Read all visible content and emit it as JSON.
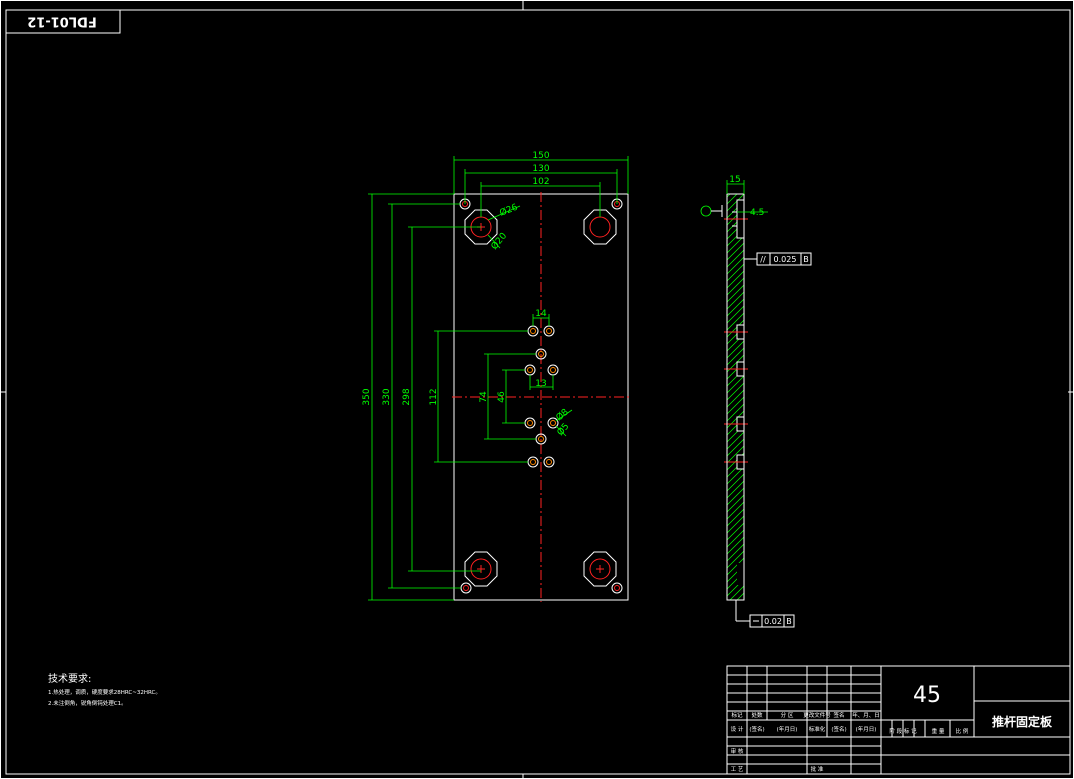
{
  "drawing_code": "FDL01-12",
  "dimensions": {
    "width_150": "150",
    "width_130": "130",
    "width_102": "102",
    "height_350": "350",
    "height_330": "330",
    "height_298": "298",
    "height_112": "112",
    "height_74": "74",
    "height_46": "46",
    "gap_14": "14",
    "gap_13": "13",
    "dia_26": "Ø26",
    "dia_20": "Ø20",
    "dia_8": "Ø8",
    "dia_5": "Ø5",
    "thickness_15": "15",
    "step_4_5": "4.5"
  },
  "tolerances": {
    "parallel": {
      "symbol": "//",
      "value": "0.025",
      "datum": "B"
    },
    "flatness": {
      "value": "0.02",
      "datum": "B"
    }
  },
  "datum_label": "B",
  "tech_requirements": {
    "title": "技术要求:",
    "items": [
      "1.热处理，调质，硬度要求28HRC~32HRC。",
      "2.未注倒角，锐角倒钝处理C1。"
    ]
  },
  "title_block": {
    "material": "45",
    "part_name": "推杆固定板",
    "row_labels": [
      "标记",
      "处数",
      "分 区",
      "更改文件号",
      "签名",
      "年、月、日"
    ],
    "design_row": [
      "设 计",
      "(签名)",
      "(年月日)",
      "标准化",
      "(签名)",
      "(年月日)"
    ],
    "stage_labels": [
      "阶 段 标 记",
      "重 量",
      "比 例"
    ],
    "review": "审 核",
    "process": "工 艺",
    "approve": "批 准"
  }
}
